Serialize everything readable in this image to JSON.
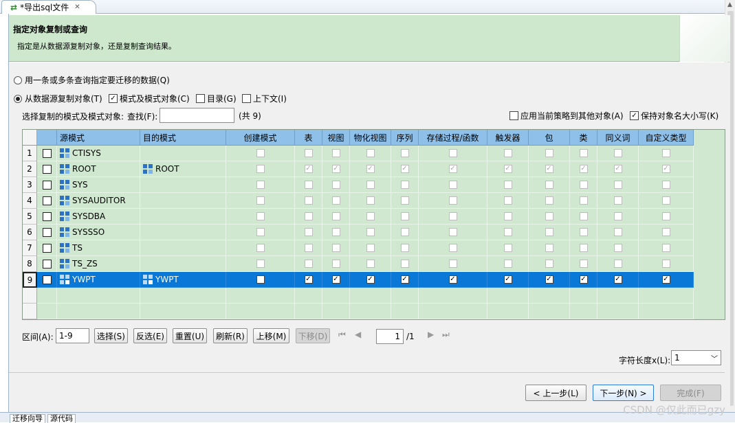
{
  "window": {
    "tab_title": "*导出sql文件",
    "tab_close": "✕"
  },
  "header": {
    "title": "指定对象复制或查询",
    "description": "指定是从数据源复制对象，还是复制查询结果。"
  },
  "options": {
    "query_radio": "用一条或多条查询指定要迁移的数据(Q)",
    "copy_radio": "从数据源复制对象(T)",
    "schema_objects": "模式及模式对象(C)",
    "catalog": "目录(G)",
    "context": "上下文(I)",
    "select_schema_label": "选择复制的模式及模式对象:",
    "find_label": "查找(F):",
    "find_value": "",
    "count": "(共 9)",
    "apply_policy": "应用当前策略到其他对象(A)",
    "keep_case": "保持对象名大小写(K)"
  },
  "table": {
    "columns": [
      "源模式",
      "目的模式",
      "创建模式",
      "表",
      "视图",
      "物化视图",
      "序列",
      "存储过程/函数",
      "触发器",
      "包",
      "类",
      "同义词",
      "自定义类型"
    ],
    "rows": [
      {
        "num": "1",
        "src": "CTISYS",
        "dst": "",
        "checked": false,
        "flags": [
          false,
          false,
          false,
          false,
          false,
          false,
          false,
          false,
          false,
          false,
          false
        ]
      },
      {
        "num": "2",
        "src": "ROOT",
        "dst": "ROOT",
        "checked": false,
        "flags": [
          false,
          true,
          true,
          true,
          true,
          true,
          true,
          true,
          true,
          true,
          true
        ]
      },
      {
        "num": "3",
        "src": "SYS",
        "dst": "",
        "checked": false,
        "flags": [
          false,
          false,
          false,
          false,
          false,
          false,
          false,
          false,
          false,
          false,
          false
        ]
      },
      {
        "num": "4",
        "src": "SYSAUDITOR",
        "dst": "",
        "checked": false,
        "flags": [
          false,
          false,
          false,
          false,
          false,
          false,
          false,
          false,
          false,
          false,
          false
        ]
      },
      {
        "num": "5",
        "src": "SYSDBA",
        "dst": "",
        "checked": false,
        "flags": [
          false,
          false,
          false,
          false,
          false,
          false,
          false,
          false,
          false,
          false,
          false
        ]
      },
      {
        "num": "6",
        "src": "SYSSSO",
        "dst": "",
        "checked": false,
        "flags": [
          false,
          false,
          false,
          false,
          false,
          false,
          false,
          false,
          false,
          false,
          false
        ]
      },
      {
        "num": "7",
        "src": "TS",
        "dst": "",
        "checked": false,
        "flags": [
          false,
          false,
          false,
          false,
          false,
          false,
          false,
          false,
          false,
          false,
          false
        ]
      },
      {
        "num": "8",
        "src": "TS_ZS",
        "dst": "",
        "checked": false,
        "flags": [
          false,
          false,
          false,
          false,
          false,
          false,
          false,
          false,
          false,
          false,
          false
        ]
      },
      {
        "num": "9",
        "src": "YWPT",
        "dst": "YWPT",
        "checked": true,
        "selected": true,
        "flags": [
          false,
          true,
          true,
          true,
          true,
          true,
          true,
          true,
          true,
          true,
          true
        ]
      }
    ]
  },
  "controls": {
    "range_label": "区间(A):",
    "range_value": "1-9",
    "select_btn": "选择(S)",
    "invert_btn": "反选(E)",
    "reset_btn": "重置(U)",
    "refresh_btn": "刷新(R)",
    "up_btn": "上移(M)",
    "down_btn": "下移(D)",
    "page_value": "1",
    "page_total": "/1",
    "strlen_label": "字符长度x(L):",
    "strlen_value": "1"
  },
  "footer": {
    "prev_btn": "< 上一步(L)",
    "next_btn": "下一步(N) >",
    "finish_btn": "完成(F)"
  },
  "bottom_tabs": [
    "迁移向导",
    "源代码"
  ],
  "watermark": "CSDN @仅此而已gzy"
}
